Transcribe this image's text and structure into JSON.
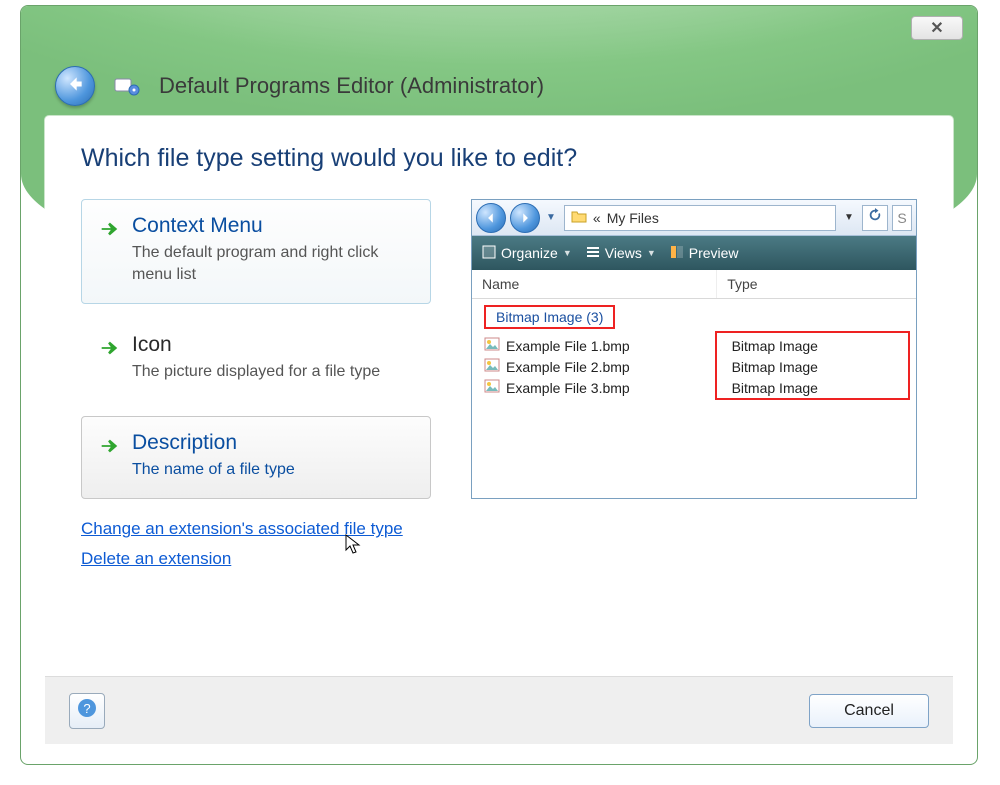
{
  "window": {
    "title": "Default Programs Editor (Administrator)",
    "close_symbol": "✕"
  },
  "question": "Which file type setting would you like to edit?",
  "options": [
    {
      "title": "Context Menu",
      "desc": "The default program and right click menu list"
    },
    {
      "title": "Icon",
      "desc": "The picture displayed for a file type"
    },
    {
      "title": "Description",
      "desc": "The name of a file type"
    }
  ],
  "links": {
    "change": "Change an extension's associated file type",
    "delete": "Delete an extension"
  },
  "preview": {
    "breadcrumb_prefix": "«",
    "breadcrumb": "My Files",
    "search_placeholder": "S",
    "toolbar": {
      "organize": "Organize",
      "views": "Views",
      "preview": "Preview"
    },
    "columns": {
      "name": "Name",
      "type": "Type"
    },
    "group_label": "Bitmap Image (3)",
    "rows": [
      {
        "name": "Example File 1.bmp",
        "type": "Bitmap Image"
      },
      {
        "name": "Example File 2.bmp",
        "type": "Bitmap Image"
      },
      {
        "name": "Example File 3.bmp",
        "type": "Bitmap Image"
      }
    ]
  },
  "footer": {
    "cancel": "Cancel"
  }
}
